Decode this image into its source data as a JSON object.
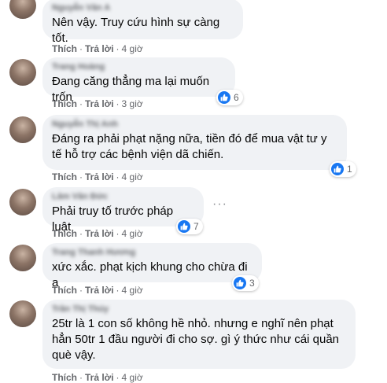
{
  "colors": {
    "accent": "#1877f2",
    "bubble": "#f0f2f5",
    "meta": "#65676b"
  },
  "icons": {
    "like": "like-thumb-icon",
    "more": "more-horiz-icon"
  },
  "labels": {
    "like": "Thích",
    "reply": "Trả lời",
    "separator": "·"
  },
  "comments": [
    {
      "author": "Nguyễn Văn A",
      "text": "Nên vậy. Truy cứu hình sự càng tốt.",
      "time": "4 giờ",
      "reactions": ""
    },
    {
      "author": "Trang Hoàng",
      "text": "Đang căng thẳng ma lại muốn trốn",
      "time": "3 giờ",
      "reactions": "6"
    },
    {
      "author": "Nguyễn Thị Anh",
      "text": "Đáng ra phải phạt nặng nữa, tiền đó để mua vật tư y tế hỗ trợ các bệnh viện dã chiến.",
      "time": "4 giờ",
      "reactions": "1"
    },
    {
      "author": "Lâm Văn Đức",
      "text": "Phải truy tố trước pháp luật",
      "time": "4 giờ",
      "reactions": "7"
    },
    {
      "author": "Trang Thanh Hương",
      "text": "xức xắc. phạt kịch khung cho chừa đi ạ",
      "time": "4 giờ",
      "reactions": "3"
    },
    {
      "author": "Trần Thị Thúy",
      "text": "25tr là 1 con số không hề nhỏ. nhưng e nghĩ nên phạt hẳn 50tr 1 đầu người đi cho sợ. gì ý thức như cái quần què vậy.",
      "time": "4 giờ",
      "reactions": ""
    }
  ]
}
